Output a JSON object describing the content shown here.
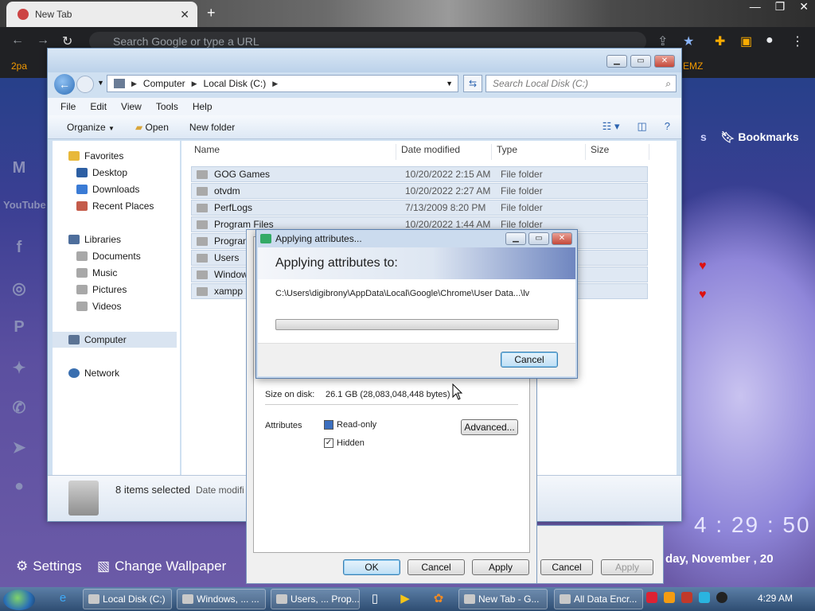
{
  "chrome": {
    "tab_title": "New Tab",
    "omnibox_placeholder": "Search Google or type a URL",
    "bookmark_left": "2pa",
    "bookmark_right": "EMZ",
    "bookmarks_label": "Bookmarks",
    "bookmarks_prefix": "s",
    "clock": "4 : 29 : 50",
    "date": "day, November , 20",
    "settings_label": "Settings",
    "wallpaper_label": "Change Wallpaper",
    "social": [
      "gmail-icon",
      "youtube-icon",
      "facebook-icon",
      "instagram-icon",
      "pinterest-icon",
      "twitter-icon",
      "whatsapp-icon",
      "telegram-icon",
      "reddit-icon"
    ],
    "youtube_text": "YouTube"
  },
  "explorer": {
    "breadcrumb": [
      "Computer",
      "Local Disk (C:)"
    ],
    "search_placeholder": "Search Local Disk (C:)",
    "menu": [
      "File",
      "Edit",
      "View",
      "Tools",
      "Help"
    ],
    "commands": {
      "organize": "Organize",
      "open": "Open",
      "new_folder": "New folder"
    },
    "nav": {
      "favorites": "Favorites",
      "desktop": "Desktop",
      "downloads": "Downloads",
      "recent": "Recent Places",
      "libraries": "Libraries",
      "documents": "Documents",
      "music": "Music",
      "pictures": "Pictures",
      "videos": "Videos",
      "computer": "Computer",
      "network": "Network"
    },
    "columns": {
      "name": "Name",
      "date": "Date modified",
      "type": "Type",
      "size": "Size"
    },
    "files": [
      {
        "name": "GOG Games",
        "date": "10/20/2022 2:15 AM",
        "type": "File folder"
      },
      {
        "name": "otvdm",
        "date": "10/20/2022 2:27 AM",
        "type": "File folder"
      },
      {
        "name": "PerfLogs",
        "date": "7/13/2009 8:20 PM",
        "type": "File folder"
      },
      {
        "name": "Program Files",
        "date": "10/20/2022 1:44 AM",
        "type": "File folder"
      },
      {
        "name": "Program",
        "date": "",
        "type": ""
      },
      {
        "name": "Users",
        "date": "",
        "type": ""
      },
      {
        "name": "Window",
        "date": "",
        "type": ""
      },
      {
        "name": "xampp",
        "date": "",
        "type": ""
      }
    ],
    "status": "8 items selected",
    "status_date": "Date modifi"
  },
  "props": {
    "size_on_disk_label": "Size on disk:",
    "size_on_disk_value": "26.1 GB (28,083,048,448 bytes)",
    "attributes_label": "Attributes",
    "readonly_label": "Read-only",
    "hidden_label": "Hidden",
    "advanced_button": "Advanced...",
    "ok": "OK",
    "cancel": "Cancel",
    "apply": "Apply",
    "cancel2": "Cancel",
    "apply2": "Apply"
  },
  "apply_dialog": {
    "title": "Applying attributes...",
    "heading": "Applying attributes to:",
    "path": "C:\\Users\\digibrony\\AppData\\Local\\Google\\Chrome\\User Data...\\lv",
    "progress": 0.0,
    "cancel": "Cancel"
  },
  "taskbar": {
    "items": [
      {
        "label": "Local Disk (C:)"
      },
      {
        "label": "Windows, ... ..."
      },
      {
        "label": "Users, ... Prop..."
      },
      {
        "label": "New Tab - G..."
      },
      {
        "label": "All Data Encr..."
      }
    ],
    "time": "4:29 AM"
  }
}
